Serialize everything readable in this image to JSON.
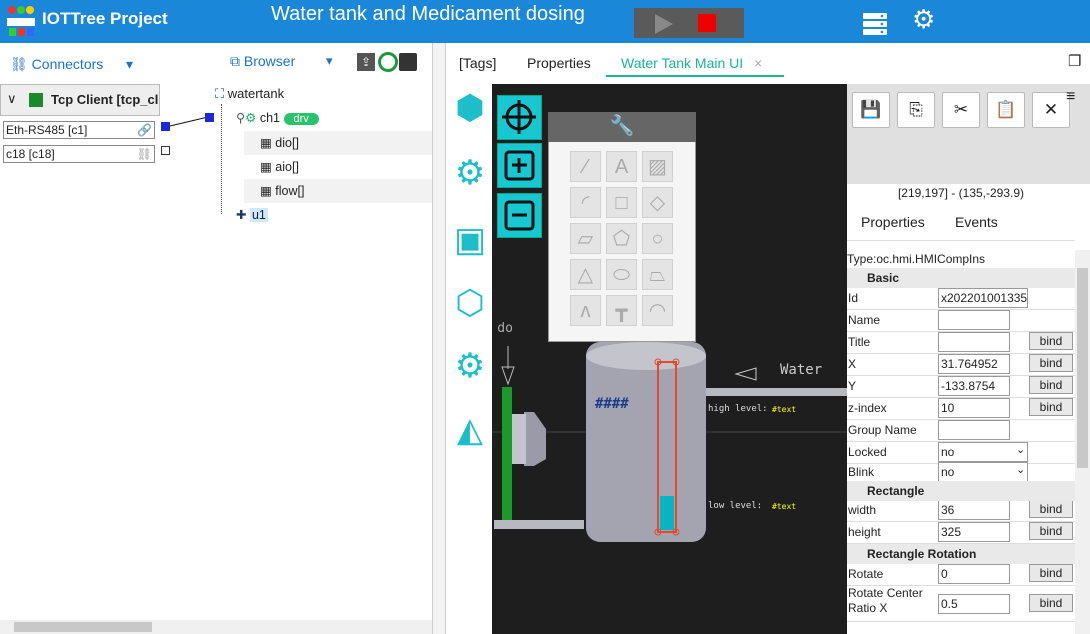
{
  "app": {
    "name": "IOTTree Project",
    "page_title": "Water tank and Medicament dosing"
  },
  "left": {
    "connectors_label": "Connectors",
    "browser_label": "Browser",
    "tcp_client": "Tcp Client [tcp_cl",
    "conns": [
      "Eth-RS485 [c1]",
      "c18 [c18]"
    ],
    "tree": {
      "root": "watertank",
      "ch": "ch1",
      "drv": "drv",
      "tags": [
        "dio[]",
        "aio[]",
        "flow[]"
      ],
      "dev": "u1"
    }
  },
  "tabs": [
    "[Tags]",
    "Properties",
    "Water Tank Main UI"
  ],
  "tab_close": "×",
  "canvas": {
    "text_dose": "ent do",
    "text_water": "Water",
    "hash": "####",
    "high": "high level:",
    "low": "low  level:",
    "stext": "#text",
    "stext2": "#text"
  },
  "right": {
    "coord": "[219,197] - (135,-293.9)",
    "tabs": [
      "Properties",
      "Events"
    ],
    "type": "Type:oc.hmi.HMICompIns",
    "sections": {
      "basic": "Basic",
      "rect": "Rectangle",
      "rot": "Rectangle Rotation"
    },
    "rows": [
      {
        "label": "Id",
        "value": "x202201001335",
        "bind": ""
      },
      {
        "label": "Name",
        "value": "",
        "bind": ""
      },
      {
        "label": "Title",
        "value": "",
        "bind": "bind"
      },
      {
        "label": "X",
        "value": "31.764952",
        "bind": "bind"
      },
      {
        "label": "Y",
        "value": "-133.8754",
        "bind": "bind"
      },
      {
        "label": "z-index",
        "value": "10",
        "bind": "bind"
      },
      {
        "label": "Group Name",
        "value": "",
        "bind": ""
      },
      {
        "label": "Locked",
        "value": "no",
        "bind": ""
      },
      {
        "label": "Blink",
        "value": "no",
        "bind": ""
      },
      {
        "label": "width",
        "value": "36",
        "bind": "bind"
      },
      {
        "label": "height",
        "value": "325",
        "bind": "bind"
      },
      {
        "label": "Rotate",
        "value": "0",
        "bind": "bind"
      },
      {
        "label": "Rotate Center Ratio X",
        "value": "0.5",
        "bind": "bind"
      }
    ]
  },
  "icons": [
    "server-icon",
    "gears-icon",
    "play-icon",
    "stop-icon"
  ]
}
